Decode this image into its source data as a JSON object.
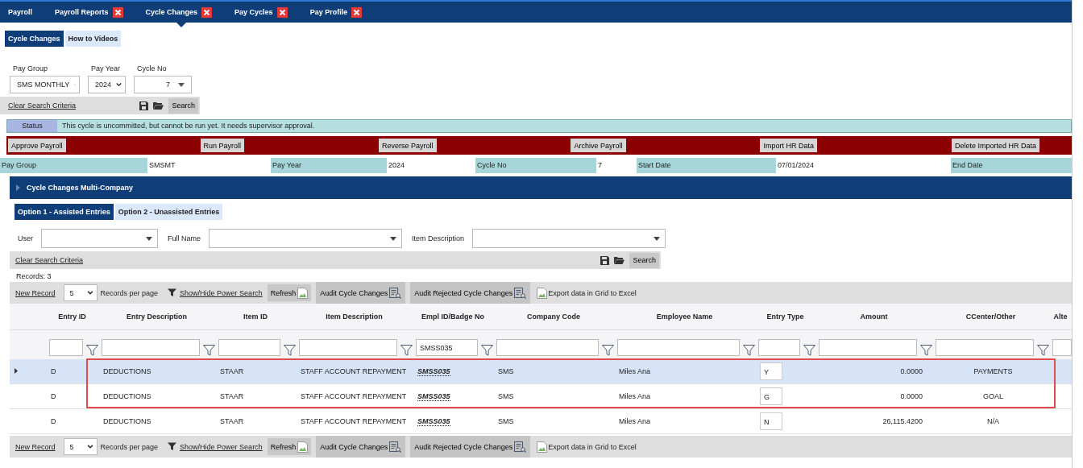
{
  "nav_tabs": [
    {
      "label": "Payroll",
      "closable": false,
      "selected": false
    },
    {
      "label": "Payroll Reports",
      "closable": true,
      "selected": false
    },
    {
      "label": "Cycle Changes",
      "closable": true,
      "selected": true
    },
    {
      "label": "Pay Cycles",
      "closable": true,
      "selected": false
    },
    {
      "label": "Pay Profile",
      "closable": true,
      "selected": false
    }
  ],
  "sub_tabs": [
    {
      "label": "Cycle Changes",
      "selected": true
    },
    {
      "label": "How to Videos",
      "selected": false
    }
  ],
  "filters": [
    {
      "label": "Pay Group",
      "value": "SMS MONTHLY",
      "kind": "select"
    },
    {
      "label": "Pay Year",
      "value": "2024",
      "kind": "select"
    },
    {
      "label": "Cycle No",
      "value": "7",
      "kind": "combo"
    }
  ],
  "search_bar": {
    "clear": "Clear Search Criteria",
    "button": "Search"
  },
  "status": {
    "label": "Status",
    "message": "This cycle is uncommitted, but cannot be run yet. It needs supervisor approval."
  },
  "actions": [
    "Approve Payroll",
    "Run Payroll",
    "Reverse Payroll",
    "Archive Payroll",
    "Import HR Data",
    "Delete Imported HR Data"
  ],
  "cycle_info": [
    {
      "label": "Pay Group",
      "value": "SMSMT"
    },
    {
      "label": "Pay Year",
      "value": "2024"
    },
    {
      "label": "Cycle No",
      "value": "7"
    },
    {
      "label": "Start Date",
      "value": "07/01/2024"
    },
    {
      "label": "End Date"
    }
  ],
  "section": {
    "title": "Cycle Changes Multi-Company",
    "expanded": false
  },
  "option_tabs": [
    {
      "label": "Option 1 - Assisted Entries",
      "selected": true
    },
    {
      "label": "Option 2 - Unassisted Entries",
      "selected": false
    }
  ],
  "entry_filters": [
    {
      "label": "User"
    },
    {
      "label": "Full Name"
    },
    {
      "label": "Item Description"
    }
  ],
  "entry_search": {
    "clear": "Clear Search Criteria",
    "button": "Search"
  },
  "records": "Records:  3",
  "toolbars": [
    {
      "new_record": "New Record",
      "page_size": "5",
      "per_page": "Records per page",
      "power_search": "Show/Hide Power Search",
      "refresh": "Refresh",
      "audit": "Audit Cycle Changes",
      "audit_rejected": "Audit Rejected Cycle Changes",
      "export": "Export data in Grid to Excel"
    },
    {
      "new_record": "New Record",
      "page_size": "5",
      "per_page": "Records per page",
      "power_search": "Show/Hide Power Search",
      "refresh": "Refresh",
      "audit": "Audit Cycle Changes",
      "audit_rejected": "Audit Rejected Cycle Changes",
      "export": "Export data in Grid to Excel"
    }
  ],
  "grid": {
    "columns": [
      {
        "label": "Entry ID",
        "kind": "text",
        "funnel": true
      },
      {
        "label": "Entry Description",
        "kind": "text",
        "funnel": true
      },
      {
        "label": "Item ID",
        "kind": "text",
        "funnel": true
      },
      {
        "label": "Item Description",
        "kind": "text",
        "funnel": true
      },
      {
        "label": "Empl ID/Badge No",
        "kind": "link",
        "funnel": true,
        "filter_value": "SMSS035"
      },
      {
        "label": "Company Code",
        "kind": "text",
        "funnel": true
      },
      {
        "label": "Employee Name",
        "kind": "text",
        "funnel": true
      },
      {
        "label": "Entry Type",
        "kind": "input",
        "funnel": true
      },
      {
        "label": "Amount",
        "kind": "number",
        "funnel": true
      },
      {
        "label": "CCenter/Other",
        "kind": "center",
        "funnel": true
      },
      {
        "label": "Alte"
      }
    ],
    "rows": [
      {
        "selected": true,
        "highlighted": true,
        "cells": [
          "D",
          "DEDUCTIONS",
          "STAAR",
          "STAFF ACCOUNT REPAYMENT",
          "SMSS035",
          "SMS",
          "Miles Ana",
          "Y",
          "0.0000",
          "PAYMENTS"
        ]
      },
      {
        "selected": false,
        "highlighted": true,
        "cells": [
          "D",
          "DEDUCTIONS",
          "STAAR",
          "STAFF ACCOUNT REPAYMENT",
          "SMSS035",
          "SMS",
          "Miles Ana",
          "G",
          "0.0000",
          "GOAL"
        ]
      },
      {
        "selected": false,
        "highlighted": false,
        "cells": [
          "D",
          "DEDUCTIONS",
          "STAAR",
          "STAFF ACCOUNT REPAYMENT",
          "SMSS035",
          "SMS",
          "Miles Ana",
          "N",
          "26,115.4200",
          "N/A"
        ]
      }
    ]
  }
}
